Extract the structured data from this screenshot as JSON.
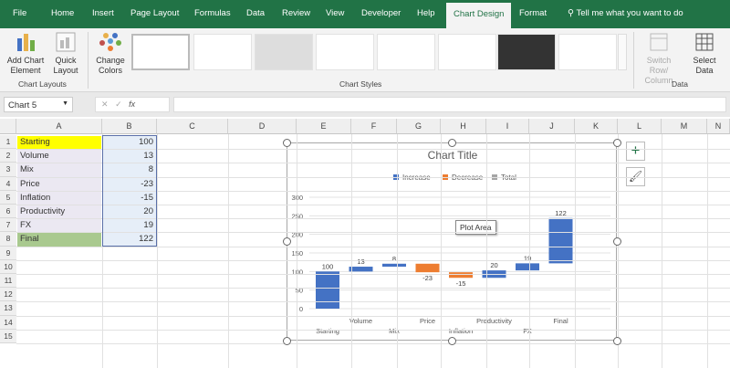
{
  "menu": {
    "tabs": [
      "File",
      "Home",
      "Insert",
      "Page Layout",
      "Formulas",
      "Data",
      "Review",
      "View",
      "Developer",
      "Help",
      "Chart Design",
      "Format"
    ],
    "active_tab": "Chart Design",
    "tell_me": "Tell me what you want to do"
  },
  "ribbon": {
    "add_chart_element": [
      "Add Chart",
      "Element"
    ],
    "quick_layout": [
      "Quick",
      "Layout"
    ],
    "change_colors": [
      "Change",
      "Colors"
    ],
    "switch_row_column": [
      "Switch Row/",
      "Column"
    ],
    "select_data": [
      "Select",
      "Data"
    ],
    "groups": {
      "chart_layouts": "Chart Layouts",
      "chart_styles": "Chart Styles",
      "data": "Data"
    }
  },
  "formula_bar": {
    "name_box": "Chart 5",
    "fx": "fx",
    "value": ""
  },
  "sheet": {
    "columns": [
      "A",
      "B",
      "C",
      "D",
      "E",
      "F",
      "G",
      "H",
      "I",
      "J",
      "K",
      "L",
      "M",
      "N"
    ],
    "rows": [
      "1",
      "2",
      "3",
      "4",
      "5",
      "6",
      "7",
      "8",
      "9",
      "10",
      "11",
      "12",
      "13",
      "14",
      "15"
    ],
    "data": [
      {
        "label": "Starting",
        "value": "100"
      },
      {
        "label": "Volume",
        "value": "13"
      },
      {
        "label": "Mix",
        "value": "8"
      },
      {
        "label": "Price",
        "value": "-23"
      },
      {
        "label": "Inflation",
        "value": "-15"
      },
      {
        "label": "Productivity",
        "value": "20"
      },
      {
        "label": "FX",
        "value": "19"
      },
      {
        "label": "Final",
        "value": "122"
      }
    ],
    "highlight_colors": {
      "Starting": "#ffff00",
      "Final": "#a9c98f"
    }
  },
  "chart": {
    "tooltip": "Plot Area",
    "side_buttons": [
      "plus-icon",
      "brush-icon"
    ]
  },
  "chart_data": {
    "type": "waterfall",
    "title": "Chart Title",
    "legend": [
      {
        "name": "Increase",
        "color": "#4472c4"
      },
      {
        "name": "Decrease",
        "color": "#ed7d31"
      },
      {
        "name": "Total",
        "color": "#a5a5a5"
      }
    ],
    "legend_position": "top",
    "categories": [
      "Starting",
      "Volume",
      "Mix",
      "Price",
      "Inflation",
      "Productivity",
      "FX",
      "Final"
    ],
    "values": [
      100,
      13,
      8,
      -23,
      -15,
      20,
      19,
      122
    ],
    "data_labels": [
      "100",
      "13",
      "8",
      "-23",
      "-15",
      "20",
      "19",
      "122"
    ],
    "ylim": [
      0,
      300
    ],
    "yticks": [
      "0",
      "50",
      "100",
      "150",
      "200",
      "250",
      "300"
    ],
    "grid": true
  }
}
